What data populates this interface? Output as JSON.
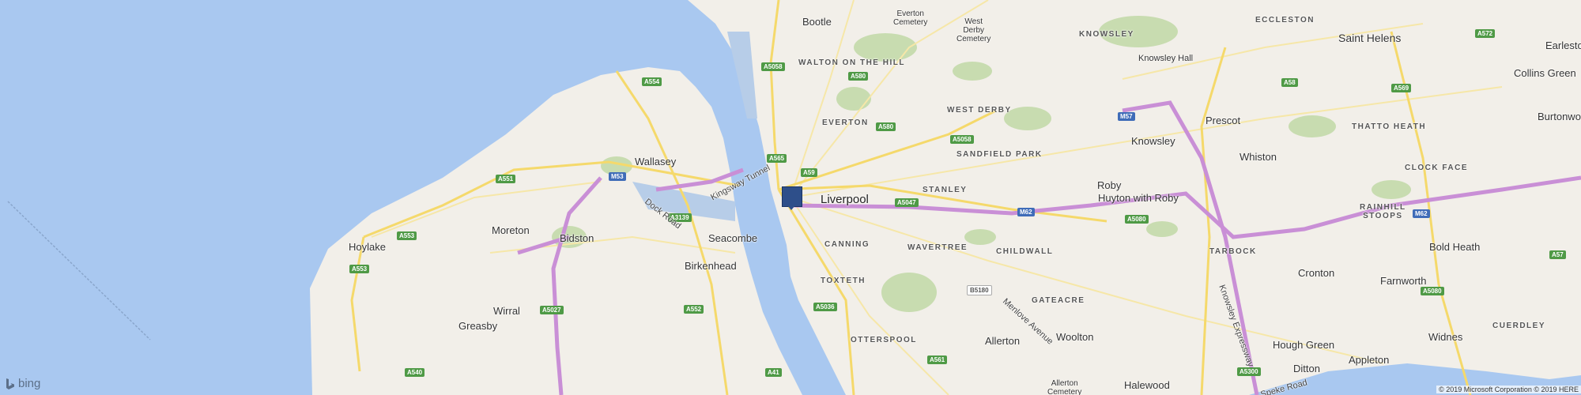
{
  "map": {
    "colors": {
      "water": "#a9c8f0",
      "land": "#f2efe9",
      "park": "#c8dcb0",
      "major_road": "#f5d96b",
      "motorway": "#c98fd6",
      "marker": "#2e4f8a"
    },
    "places": {
      "bootle": "Bootle",
      "everton_cemetery": "Everton\nCemetery",
      "west_derby_cemetery": "West\nDerby\nCemetery",
      "eccleston": "ECCLESTON",
      "saint_helens": "Saint Helens",
      "earlestown": "Earlesto",
      "knowsley_district": "KNOWSLEY",
      "knowsley_hall": "Knowsley Hall",
      "collins_green": "Collins Green",
      "walton": "WALTON ON THE HILL",
      "everton": "EVERTON",
      "west_derby": "WEST DERBY",
      "prescot": "Prescot",
      "burtonwood": "Burtonwoo",
      "thatto_heath": "THATTO HEATH",
      "wallasey": "Wallasey",
      "knowsley": "Knowsley",
      "sandfield_park": "SANDFIELD PARK",
      "whiston": "Whiston",
      "clock_face": "CLOCK FACE",
      "stanley": "STANLEY",
      "liverpool": "Liverpool",
      "roby": "Roby",
      "huyton": "Huyton with Roby",
      "rainhill": "RAINHILL\nSTOOPS",
      "hoylake": "Hoylake",
      "moreton": "Moreton",
      "bidston": "Bidston",
      "seacombe": "Seacombe",
      "canning": "CANNING",
      "wavertree": "WAVERTREE",
      "childwall": "CHILDWALL",
      "tarbock": "TARBOCK",
      "bold_heath": "Bold Heath",
      "birkenhead": "Birkenhead",
      "toxteth": "TOXTETH",
      "cronton": "Cronton",
      "farnworth": "Farnworth",
      "wirral": "Wirral",
      "gateacre": "GATEACRE",
      "greasby": "Greasby",
      "widnes": "Widnes",
      "cuerdley": "CUERDLEY",
      "otterspool": "OTTERSPOOL",
      "allerton": "Allerton",
      "woolton": "Woolton",
      "hough_green": "Hough Green",
      "ditton": "Ditton",
      "appleton": "Appleton",
      "allerton_cemetery": "Allerton\nCemetery",
      "halewood": "Halewood"
    },
    "roads": {
      "a554": "A554",
      "a5058_top": "A5058",
      "a580_top": "A580",
      "a580_mid": "A580",
      "a565": "A565",
      "a59": "A59",
      "a5058_mid": "A5058",
      "m53": "M53",
      "a551": "A551",
      "a3139": "A3139",
      "a5047": "A5047",
      "m62_mid": "M62",
      "m57": "M57",
      "a572": "A572",
      "a58": "A58",
      "a569": "A569",
      "a553_a": "A553",
      "a553_b": "A553",
      "a5080_mid": "A5080",
      "a57": "A57",
      "m62_right": "M62",
      "a5027": "A5027",
      "a552": "A552",
      "b5180": "B5180",
      "a5036": "A5036",
      "a5080_right": "A5080",
      "a540": "A540",
      "a561": "A561",
      "a41": "A41",
      "a5300": "A5300"
    },
    "road_names": {
      "kingsway": "Kingsway Tunnel",
      "dock_road": "Dock Road",
      "menlove": "Menlove Avenue",
      "knowsley_expressway": "Knowsley Expressway",
      "speke_road": "Speke Road"
    },
    "marker": {
      "name": "location-marker",
      "place": "Liverpool"
    },
    "attribution": {
      "logo_text": "bing",
      "copyright": "© 2019 Microsoft Corporation © 2019 HERE"
    }
  }
}
